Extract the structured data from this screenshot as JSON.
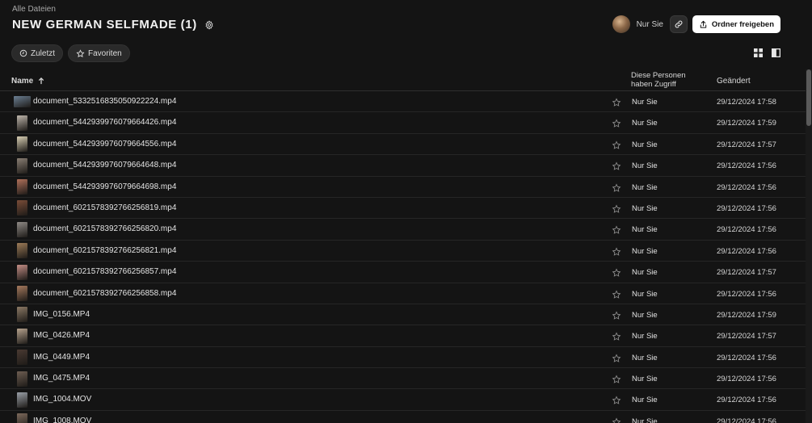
{
  "breadcrumb": "Alle Dateien",
  "page_title": "NEW GERMAN SELFMADE (1)",
  "share": {
    "owner_label": "Nur Sie",
    "share_button_label": "Ordner freigeben"
  },
  "filters": {
    "recent_label": "Zuletzt",
    "favorites_label": "Favoriten"
  },
  "table": {
    "col_name": "Name",
    "col_access": "Diese Personen haben Zugriff",
    "col_changed": "Geändert",
    "rows": [
      {
        "name": "document_5332516835050922224.mp4",
        "access": "Nur Sie",
        "changed": "29/12/2024 17:58",
        "thumb_color": "#6b7f93",
        "thumb_wide": true
      },
      {
        "name": "document_5442939976079664426.mp4",
        "access": "Nur Sie",
        "changed": "29/12/2024 17:59",
        "thumb_color": "#bfb7ad",
        "thumb_wide": false
      },
      {
        "name": "document_5442939976079664556.mp4",
        "access": "Nur Sie",
        "changed": "29/12/2024 17:57",
        "thumb_color": "#d8cfb4",
        "thumb_wide": false
      },
      {
        "name": "document_5442939976079664648.mp4",
        "access": "Nur Sie",
        "changed": "29/12/2024 17:56",
        "thumb_color": "#8a7f74",
        "thumb_wide": false
      },
      {
        "name": "document_5442939976079664698.mp4",
        "access": "Nur Sie",
        "changed": "29/12/2024 17:56",
        "thumb_color": "#b0705a",
        "thumb_wide": false
      },
      {
        "name": "document_6021578392766256819.mp4",
        "access": "Nur Sie",
        "changed": "29/12/2024 17:56",
        "thumb_color": "#7a4d38",
        "thumb_wide": false
      },
      {
        "name": "document_6021578392766256820.mp4",
        "access": "Nur Sie",
        "changed": "29/12/2024 17:56",
        "thumb_color": "#8f8a86",
        "thumb_wide": false
      },
      {
        "name": "document_6021578392766256821.mp4",
        "access": "Nur Sie",
        "changed": "29/12/2024 17:56",
        "thumb_color": "#9c7b58",
        "thumb_wide": false
      },
      {
        "name": "document_6021578392766256857.mp4",
        "access": "Nur Sie",
        "changed": "29/12/2024 17:57",
        "thumb_color": "#c48e86",
        "thumb_wide": false
      },
      {
        "name": "document_6021578392766256858.mp4",
        "access": "Nur Sie",
        "changed": "29/12/2024 17:56",
        "thumb_color": "#a67a5e",
        "thumb_wide": false
      },
      {
        "name": "IMG_0156.MP4",
        "access": "Nur Sie",
        "changed": "29/12/2024 17:59",
        "thumb_color": "#8c7a66",
        "thumb_wide": false
      },
      {
        "name": "IMG_0426.MP4",
        "access": "Nur Sie",
        "changed": "29/12/2024 17:57",
        "thumb_color": "#b7a38e",
        "thumb_wide": false
      },
      {
        "name": "IMG_0449.MP4",
        "access": "Nur Sie",
        "changed": "29/12/2024 17:56",
        "thumb_color": "#4a3a32",
        "thumb_wide": false
      },
      {
        "name": "IMG_0475.MP4",
        "access": "Nur Sie",
        "changed": "29/12/2024 17:56",
        "thumb_color": "#6e5e52",
        "thumb_wide": false
      },
      {
        "name": "IMG_1004.MOV",
        "access": "Nur Sie",
        "changed": "29/12/2024 17:56",
        "thumb_color": "#9aa0a8",
        "thumb_wide": false
      },
      {
        "name": "IMG_1008.MOV",
        "access": "Nur Sie",
        "changed": "29/12/2024 17:56",
        "thumb_color": "#7d6a5c",
        "thumb_wide": false
      }
    ]
  },
  "colors": {
    "background": "#141414",
    "row_divider": "#262626",
    "primary_button_bg": "#ffffff"
  }
}
